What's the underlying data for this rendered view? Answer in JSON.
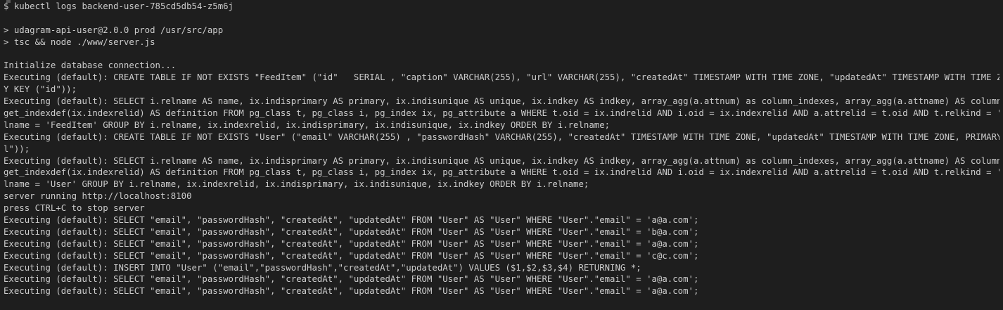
{
  "terminal": {
    "colors": {
      "background": "#1e1e1e",
      "foreground": "#cccccc",
      "top_fragment_yellow": "#e5e510",
      "top_fragment_blue": "#2472c8"
    },
    "lines": [
      "$ kubectl logs backend-user-785cd5db54-z5m6j",
      "",
      "> udagram-api-user@2.0.0 prod /usr/src/app",
      "> tsc && node ./www/server.js",
      "",
      "Initialize database connection...",
      "Executing (default): CREATE TABLE IF NOT EXISTS \"FeedItem\" (\"id\"   SERIAL , \"caption\" VARCHAR(255), \"url\" VARCHAR(255), \"createdAt\" TIMESTAMP WITH TIME ZONE, \"updatedAt\" TIMESTAMP WITH TIME ZONE, PRIMAR",
      "Y KEY (\"id\"));",
      "Executing (default): SELECT i.relname AS name, ix.indisprimary AS primary, ix.indisunique AS unique, ix.indkey AS indkey, array_agg(a.attnum) as column_indexes, array_agg(a.attname) AS column_names, pg_",
      "get_indexdef(ix.indexrelid) AS definition FROM pg_class t, pg_class i, pg_index ix, pg_attribute a WHERE t.oid = ix.indrelid AND i.oid = ix.indexrelid AND a.attrelid = t.oid AND t.relkind = 'r' and t.re",
      "lname = 'FeedItem' GROUP BY i.relname, ix.indexrelid, ix.indisprimary, ix.indisunique, ix.indkey ORDER BY i.relname;",
      "Executing (default): CREATE TABLE IF NOT EXISTS \"User\" (\"email\" VARCHAR(255) , \"passwordHash\" VARCHAR(255), \"createdAt\" TIMESTAMP WITH TIME ZONE, \"updatedAt\" TIMESTAMP WITH TIME ZONE, PRIMARY KEY (\"emai",
      "l\"));",
      "Executing (default): SELECT i.relname AS name, ix.indisprimary AS primary, ix.indisunique AS unique, ix.indkey AS indkey, array_agg(a.attnum) as column_indexes, array_agg(a.attname) AS column_names, pg_",
      "get_indexdef(ix.indexrelid) AS definition FROM pg_class t, pg_class i, pg_index ix, pg_attribute a WHERE t.oid = ix.indrelid AND i.oid = ix.indexrelid AND a.attrelid = t.oid AND t.relkind = 'r' and t.re",
      "lname = 'User' GROUP BY i.relname, ix.indexrelid, ix.indisprimary, ix.indisunique, ix.indkey ORDER BY i.relname;",
      "server running http://localhost:8100",
      "press CTRL+C to stop server",
      "Executing (default): SELECT \"email\", \"passwordHash\", \"createdAt\", \"updatedAt\" FROM \"User\" AS \"User\" WHERE \"User\".\"email\" = 'a@a.com';",
      "Executing (default): SELECT \"email\", \"passwordHash\", \"createdAt\", \"updatedAt\" FROM \"User\" AS \"User\" WHERE \"User\".\"email\" = 'b@a.com';",
      "Executing (default): SELECT \"email\", \"passwordHash\", \"createdAt\", \"updatedAt\" FROM \"User\" AS \"User\" WHERE \"User\".\"email\" = 'a@a.com';",
      "Executing (default): SELECT \"email\", \"passwordHash\", \"createdAt\", \"updatedAt\" FROM \"User\" AS \"User\" WHERE \"User\".\"email\" = 'c@c.com';",
      "Executing (default): INSERT INTO \"User\" (\"email\",\"passwordHash\",\"createdAt\",\"updatedAt\") VALUES ($1,$2,$3,$4) RETURNING *;",
      "Executing (default): SELECT \"email\", \"passwordHash\", \"createdAt\", \"updatedAt\" FROM \"User\" AS \"User\" WHERE \"User\".\"email\" = 'a@a.com';",
      "Executing (default): SELECT \"email\", \"passwordHash\", \"createdAt\", \"updatedAt\" FROM \"User\" AS \"User\" WHERE \"User\".\"email\" = 'a@a.com';"
    ]
  }
}
